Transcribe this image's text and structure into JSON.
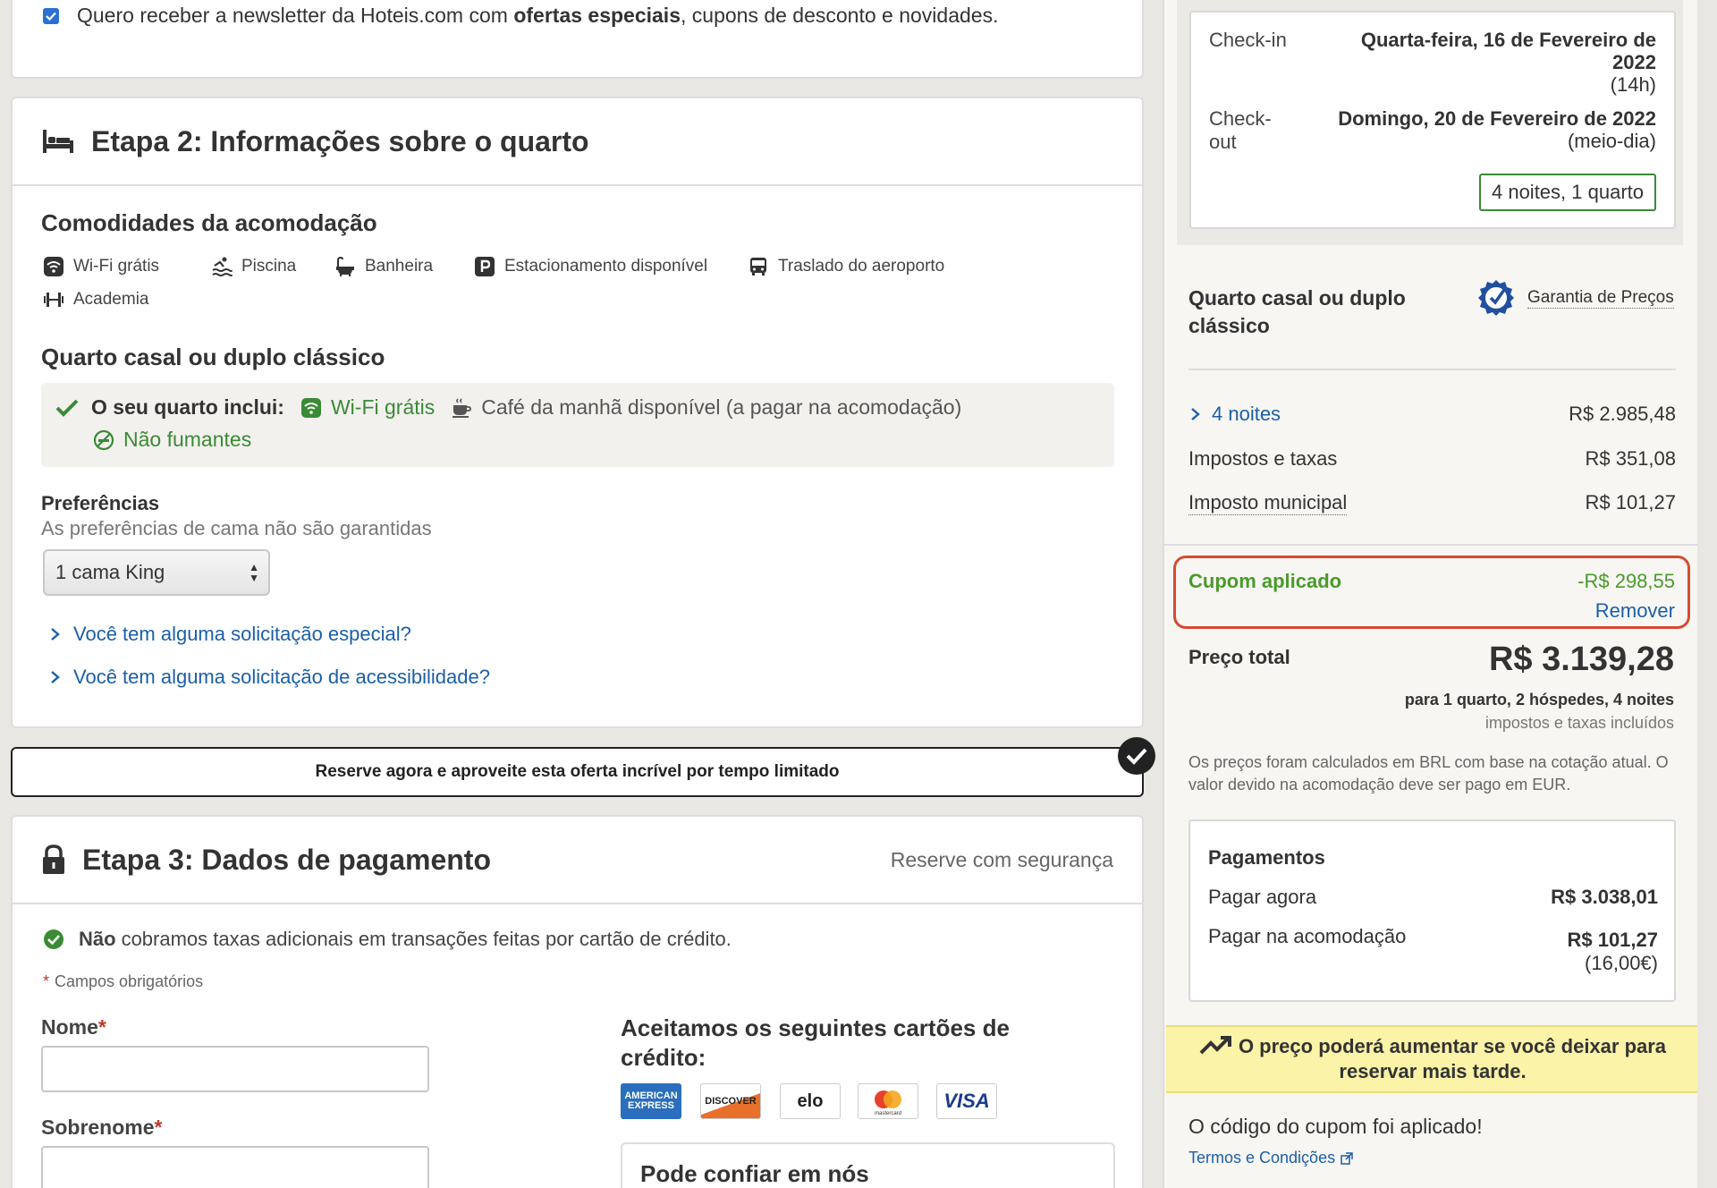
{
  "newsletter": {
    "text_before": "Quero receber a newsletter da Hoteis.com com ",
    "text_bold": "ofertas especiais",
    "text_after": ", cupons de desconto e novidades.",
    "checked": true
  },
  "step2": {
    "title": "Etapa 2: Informações sobre o quarto",
    "amenities_title": "Comodidades da acomodação",
    "amenities": [
      {
        "label": "Wi-Fi grátis",
        "icon": "wifi-icon"
      },
      {
        "label": "Piscina",
        "icon": "pool-icon"
      },
      {
        "label": "Banheira",
        "icon": "bathtub-icon"
      },
      {
        "label": "Estacionamento disponível",
        "icon": "parking-icon"
      },
      {
        "label": "Traslado do aeroporto",
        "icon": "shuttle-icon"
      },
      {
        "label": "Academia",
        "icon": "gym-icon"
      }
    ],
    "room_title": "Quarto casal ou duplo clássico",
    "includes_label": "O seu quarto inclui:",
    "includes": {
      "wifi": "Wi-Fi grátis",
      "breakfast": "Café da manhã disponível (a pagar na acomodação)",
      "nonsmoking": "Não fumantes"
    },
    "preferences_title": "Preferências",
    "preferences_sub": "As preferências de cama não são garantidas",
    "bed_select": "1 cama King",
    "special_request": "Você tem alguma solicitação especial?",
    "accessibility_request": "Você tem alguma solicitação de acessibilidade?"
  },
  "banner": "Reserve agora e aproveite esta oferta incrível por tempo limitado",
  "step3": {
    "title": "Etapa 3: Dados de pagamento",
    "secure": "Reserve com segurança",
    "note_bold": "Não",
    "note_rest": "cobramos taxas adicionais em transações feitas por cartão de crédito.",
    "required": "Campos obrigatórios",
    "first_name_label": "Nome",
    "last_name_label": "Sobrenome",
    "asterisk": "*",
    "cards_title": "Aceitamos os seguintes cartões de crédito:",
    "cards": [
      "AMERICAN EXPRESS",
      "DISCOVER",
      "elo",
      "mastercard",
      "VISA"
    ],
    "trust_title": "Pode confiar em nós"
  },
  "sidebar": {
    "checkin_label": "Check-in",
    "checkin_line1": "Quarta-feira, 16 de Fevereiro de",
    "checkin_line2": "2022",
    "checkin_time": "(14h)",
    "checkout_label_1": "Check-",
    "checkout_label_2": "out",
    "checkout_value": "Domingo, 20 de Fevereiro de 2022",
    "checkout_time": "(meio-dia)",
    "nights_badge": "4 noites, 1 quarto",
    "room_name": "Quarto casal ou duplo clássico",
    "guarantee": "Garantia de Preços",
    "nights_label": "4 noites",
    "nights_value": "R$ 2.985,48",
    "taxes_label": "Impostos e taxas",
    "taxes_value": "R$ 351,08",
    "city_tax_label": "Imposto municipal",
    "city_tax_value": "R$ 101,27",
    "coupon_label": "Cupom aplicado",
    "coupon_value": "-R$ 298,55",
    "coupon_remove": "Remover",
    "total_label": "Preço total",
    "total_value": "R$ 3.139,28",
    "total_sub": "para 1 quarto, 2 hóspedes, 4 noites",
    "total_sub2": "impostos e taxas incluídos",
    "calc_note": "Os preços foram calculados em BRL com base na cotação atual. O valor devido na acomodação deve ser pago em EUR.",
    "payments_title": "Pagamentos",
    "pay_now_label": "Pagar agora",
    "pay_now_value": "R$ 3.038,01",
    "pay_hotel_label": "Pagar na acomodação",
    "pay_hotel_value": "R$ 101,27",
    "pay_hotel_eur": "(16,00€)",
    "warning": "O preço poderá aumentar se você deixar para reservar mais tarde.",
    "coupon_applied": "O código do cupom foi aplicado!",
    "terms": "Termos e Condições"
  },
  "colors": {
    "link": "#1b5fa8",
    "green": "#3a8a36",
    "coupon_green": "#4a9a2a",
    "coupon_border": "#d64a32",
    "warning_bg": "#faf3a8"
  }
}
